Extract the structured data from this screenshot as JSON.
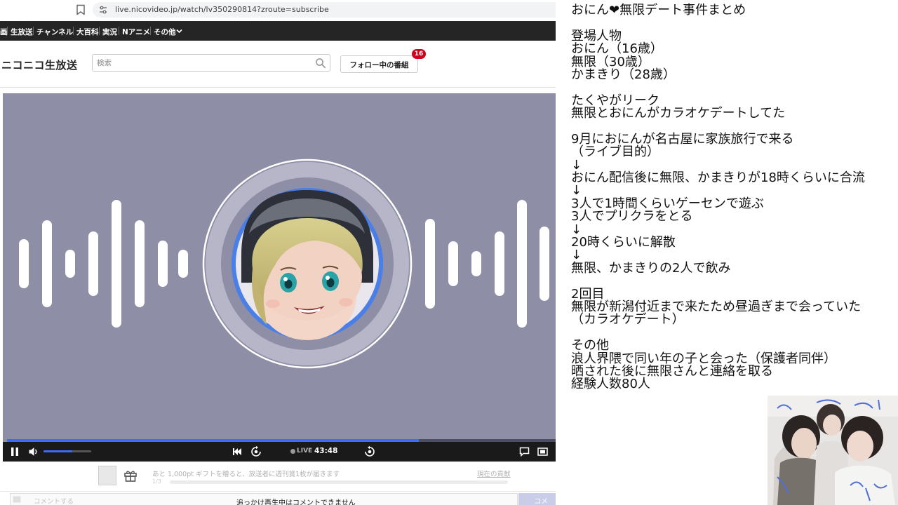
{
  "browser": {
    "url": "live.nicovideo.jp/watch/lv350290814?zroute=subscribe"
  },
  "nav": {
    "items": [
      "画",
      "生放送",
      "チャンネル",
      "大百科",
      "実況",
      "Nアニメ",
      "その他"
    ]
  },
  "header": {
    "logo": "ニコニコ生放送",
    "search_placeholder": "検索",
    "follow_label": "フォロー中の番組",
    "follow_badge": "16"
  },
  "player": {
    "background": "#8e8ea6",
    "progress": 0.75,
    "volume": 0.6,
    "live_label": "LIVE",
    "time": "43:48"
  },
  "gift": {
    "text": "あと 1,000pt ギフトを贈ると、放送者に週刊賞1枚が届きます",
    "sub": "1/3",
    "link": "現在の貢献"
  },
  "comment": {
    "placeholder": "コメントする",
    "notice": "追っかけ再生中はコメントできません",
    "send": "コメ"
  },
  "notes": [
    "おにん❤無限デート事件まとめ",
    "",
    "登場人物",
    "おにん（16歳）",
    "無限（30歳）",
    "かまきり（28歳）",
    "",
    "たくやがリーク",
    "無限とおにんがカラオケデートしてた",
    "",
    "9月におにんが名古屋に家族旅行で来る",
    "（ライブ目的）",
    "↓",
    "おにん配信後に無限、かまきりが18時くらいに合流",
    "↓",
    "3人で1時間くらいゲーセンで遊ぶ",
    "3人でプリクラをとる",
    "↓",
    "20時くらいに解散",
    "↓",
    "無限、かまきりの2人で飲み",
    "",
    "2回目",
    "無限が新潟付近まで来たため昼過ぎまで会っていた",
    "（カラオケデート）",
    "",
    "その他",
    "浪人界隈で同い年の子と会った（保護者同伴）",
    "晒された後に無限さんと連絡を取る",
    "経験人数80人"
  ],
  "colors": {
    "nav_bg": "#252525",
    "accent": "#3d6bff",
    "badge": "#d0021b"
  }
}
